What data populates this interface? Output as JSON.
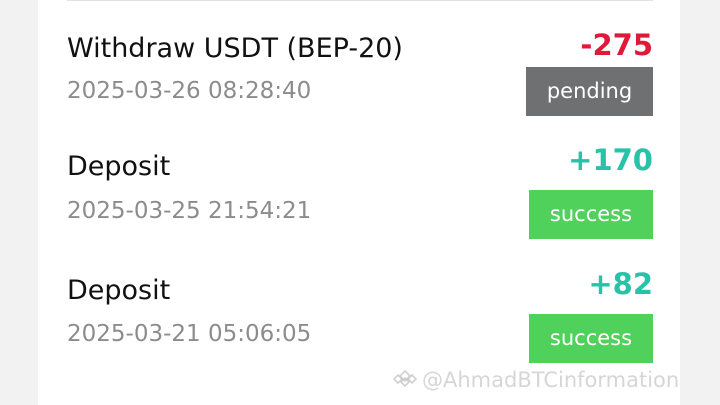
{
  "transactions": [
    {
      "title": "Withdraw USDT (BEP-20)",
      "time": "2025-03-26 08:28:40",
      "amount": "-275",
      "status": "pending"
    },
    {
      "title": "Deposit",
      "time": "2025-03-25 21:54:21",
      "amount": "+170",
      "status": "success"
    },
    {
      "title": "Deposit",
      "time": "2025-03-21 05:06:05",
      "amount": "+82",
      "status": "success"
    }
  ],
  "colors": {
    "negative": "#e0193b",
    "positive": "#28c2a8",
    "pending_badge": "#6f7071",
    "success_badge": "#4fd15c"
  },
  "watermark": {
    "text": "@AhmadBTCinformation",
    "icon": "binance-square-logo-icon"
  }
}
